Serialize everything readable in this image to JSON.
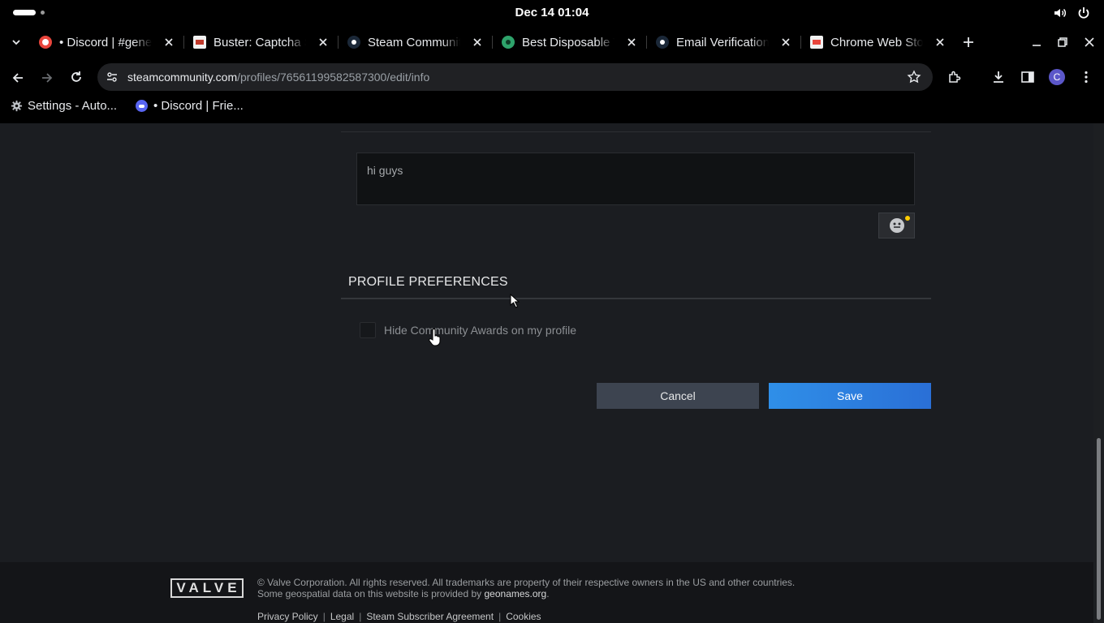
{
  "os": {
    "clock": "Dec 14  01:04"
  },
  "browser": {
    "tabs": [
      {
        "title": "• Discord | #general",
        "icon": "discord-icon",
        "color": "#e8453c"
      },
      {
        "title": "Buster: Captcha Solver",
        "icon": "buster-icon",
        "color": "#c0392b"
      },
      {
        "title": "Steam Community",
        "icon": "steam-icon",
        "color": "#66c0f4"
      },
      {
        "title": "Best Disposable Temp",
        "icon": "temp-mail-icon",
        "color": "#2ea36b"
      },
      {
        "title": "Email Verification",
        "icon": "steam-icon",
        "color": "#66c0f4"
      },
      {
        "title": "Chrome Web Store",
        "icon": "webstore-icon",
        "color": "#e8453c"
      }
    ],
    "url_host": "steamcommunity.com",
    "url_path": "/profiles/76561199582587300/edit/info",
    "profile_initial": "C",
    "bookmarks": [
      {
        "label": "Settings - Auto...",
        "icon": "gear-icon"
      },
      {
        "label": "• Discord | Frie...",
        "icon": "discord-icon"
      }
    ]
  },
  "page": {
    "summary_text": "hi guys",
    "preferences_title": "PROFILE PREFERENCES",
    "hide_awards_label": "Hide Community Awards on my profile",
    "hide_awards_checked": false,
    "cancel_label": "Cancel",
    "save_label": "Save"
  },
  "footer": {
    "logo_text": "VALVE",
    "copyright": "© Valve Corporation. All rights reserved. All trademarks are property of their respective owners in the US and other countries.",
    "geo_prefix": "Some geospatial data on this website is provided by ",
    "geo_link": "geonames.org",
    "geo_suffix": ".",
    "links": [
      "Privacy Policy",
      "Legal",
      "Steam Subscriber Agreement",
      "Cookies"
    ]
  },
  "colors": {
    "page_bg": "#1b1d21",
    "save_button": "#2f8fe8",
    "cancel_button": "#3d4450"
  }
}
